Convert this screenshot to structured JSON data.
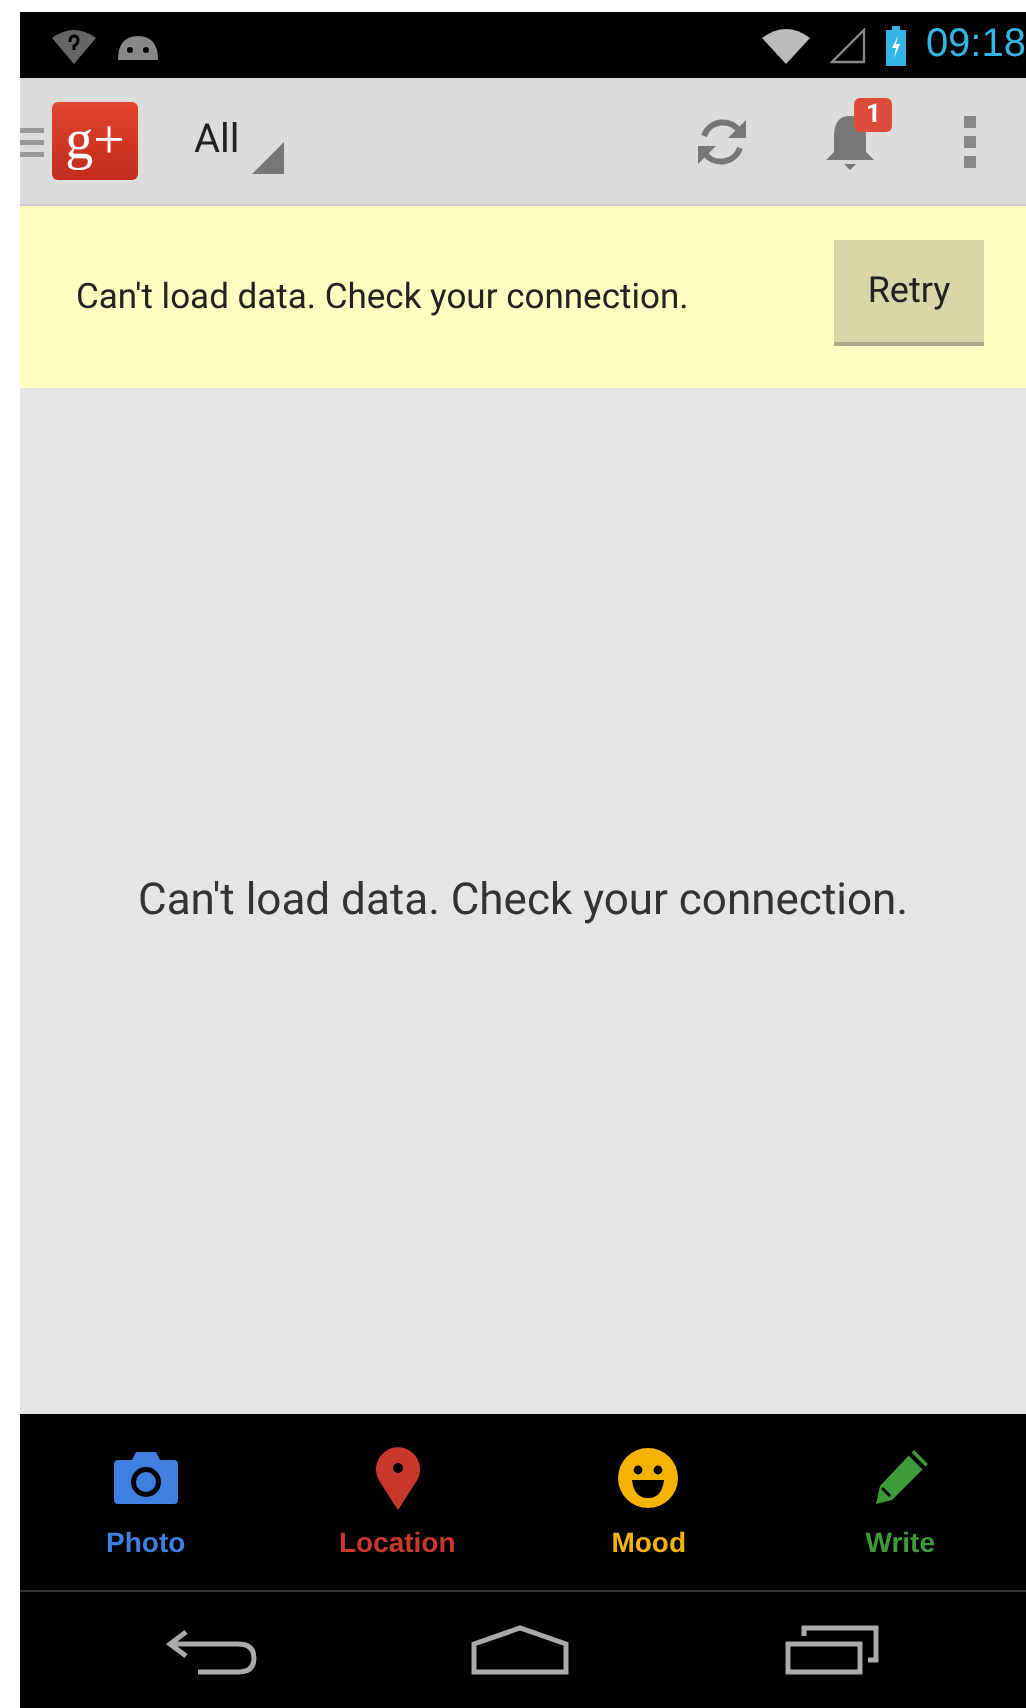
{
  "status_bar": {
    "time": "09:18"
  },
  "action_bar": {
    "logo": "g+",
    "stream": "All",
    "notification_count": "1"
  },
  "banner": {
    "message": "Can't load data. Check your connection.",
    "button": "Retry"
  },
  "empty_message": "Can't load data. Check your connection.",
  "compose_actions": [
    {
      "kind": "photo",
      "label": "Photo",
      "color": "#3f7fe0"
    },
    {
      "kind": "location",
      "label": "Location",
      "color": "#c9382c"
    },
    {
      "kind": "mood",
      "label": "Mood",
      "color": "#f4b400"
    },
    {
      "kind": "write",
      "label": "Write",
      "color": "#3f9a3a"
    }
  ]
}
